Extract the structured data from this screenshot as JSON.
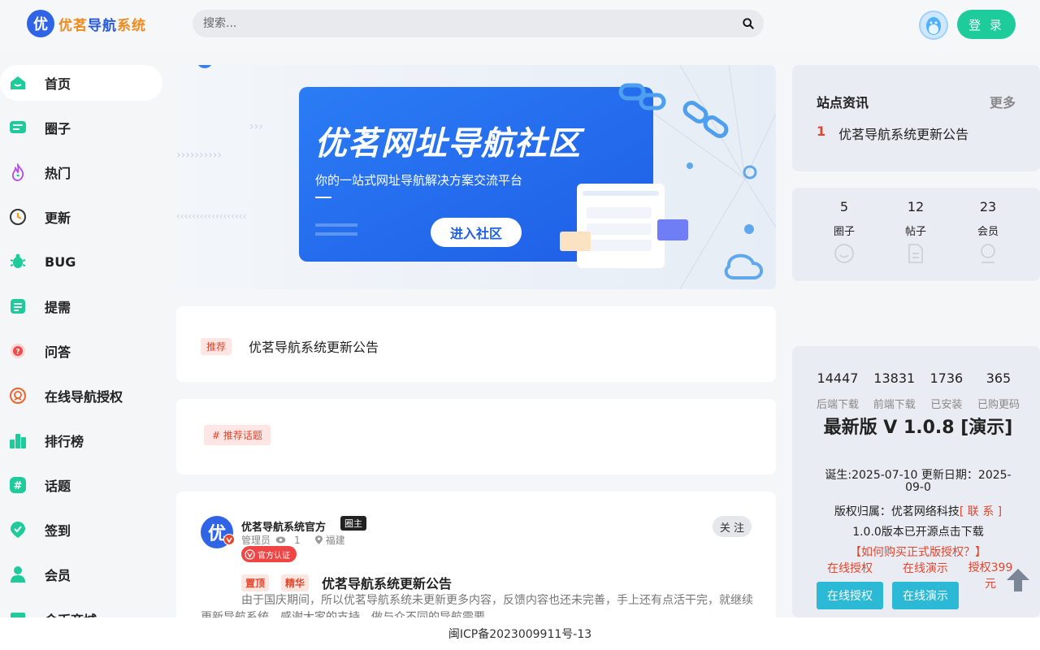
{
  "header": {
    "logo_badge": "优",
    "logo_part1": "优茗",
    "logo_part2": "导航",
    "logo_part3": "系统",
    "search_placeholder": "搜索...",
    "login_label": "登 录"
  },
  "sidebar": {
    "items": [
      {
        "label": "首页",
        "icon": "home-icon"
      },
      {
        "label": "圈子",
        "icon": "chat-icon"
      },
      {
        "label": "热门",
        "icon": "fire-icon"
      },
      {
        "label": "更新",
        "icon": "update-icon"
      },
      {
        "label": "BUG",
        "icon": "bug-icon"
      },
      {
        "label": "提需",
        "icon": "doc-icon"
      },
      {
        "label": "问答",
        "icon": "question-icon"
      },
      {
        "label": "在线导航授权",
        "icon": "award-icon"
      },
      {
        "label": "排行榜",
        "icon": "rank-icon"
      },
      {
        "label": "话题",
        "icon": "hash-icon"
      },
      {
        "label": "签到",
        "icon": "checkin-icon"
      },
      {
        "label": "会员",
        "icon": "user-icon"
      },
      {
        "label": "金币商城",
        "icon": "shop-icon"
      }
    ]
  },
  "banner": {
    "title": "优茗网址导航社区",
    "subtitle": "你的一站式网址导航解决方案交流平台",
    "button": "进入社区"
  },
  "recommend_card": {
    "tag": "推荐",
    "title": "优茗导航系统更新公告"
  },
  "topic_card": {
    "tag": "# 推荐话题"
  },
  "post": {
    "avatar_char": "优",
    "author": "优茗导航系统官方",
    "role_badge": "圈主",
    "meta_role": "管理员",
    "views": "1",
    "location": "福建",
    "verified": "官方认证",
    "follow": "关 注",
    "tag_top": "置顶",
    "tag_best": "精华",
    "title": "优茗导航系统更新公告",
    "excerpt": "由于国庆期间，所以优茗导航系统未更新更多内容，反馈内容也还未完善，手上还有点活干完，就继续更新导航系统，感谢大家的支持，做与众不同的导航需要"
  },
  "news": {
    "title": "站点资讯",
    "more": "更多",
    "items": [
      {
        "num": "1",
        "text": "优茗导航系统更新公告"
      }
    ]
  },
  "stats": [
    {
      "value": "5",
      "label": "圈子",
      "icon": "circle-icon"
    },
    {
      "value": "12",
      "label": "帖子",
      "icon": "post-icon"
    },
    {
      "value": "23",
      "label": "会员",
      "icon": "member-icon"
    }
  ],
  "download": {
    "counts": [
      {
        "value": "14447",
        "label": "后端下载"
      },
      {
        "value": "13831",
        "label": "前端下载"
      },
      {
        "value": "1736",
        "label": "已安装"
      },
      {
        "value": "365",
        "label": "已购更码"
      }
    ],
    "version_title": "最新版 V 1.0.8 [演示]",
    "dates": "诞生:2025-07-10 更新日期：2025-09-0",
    "copyright_prefix": "版权归属：优茗网络科技",
    "contact": "[ 联 系 ]",
    "opensource": "1.0.0版本已开源点击下载",
    "buy_link": "【如何购买正式版授权？】",
    "link1": "在线授权",
    "link2": "在线演示",
    "link3": "授权399元",
    "btn1": "在线授权",
    "btn2": "在线演示"
  },
  "footer": {
    "icp": "闽ICP备2023009911号-13"
  },
  "colors": {
    "accent": "#1dcc9a",
    "blue": "#2f64e6",
    "red": "#e4452c"
  }
}
